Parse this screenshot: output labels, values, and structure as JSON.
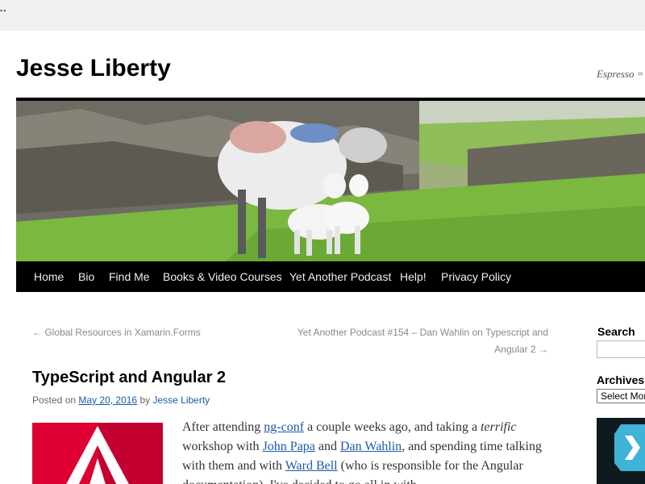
{
  "browser": {
    "dots": "▪▪"
  },
  "site": {
    "title": "Jesse Liberty",
    "tagline": "Espresso = Code"
  },
  "nav": {
    "items": [
      {
        "label": "Home"
      },
      {
        "label": "Bio"
      },
      {
        "label": "Find Me"
      },
      {
        "label": "Books & Video Courses"
      },
      {
        "label": "Yet Another Podcast"
      },
      {
        "label": "Help!"
      },
      {
        "label": "Privacy Policy"
      }
    ]
  },
  "post_nav": {
    "prev": "← Global Resources in Xamarin.Forms",
    "next": "Yet Another Podcast #154 – Dan Wahlin on Typescript and Angular 2 →"
  },
  "post": {
    "title": "TypeScript and Angular 2",
    "meta_posted": "Posted on",
    "date": "May 20, 2016",
    "meta_by": "by",
    "author": "Jesse Liberty",
    "p1": "After attending ",
    "link_ngconf": "ng-conf",
    "p2": " a couple weeks ago, and taking a ",
    "em_terrific": "terrific",
    "p3": " workshop with ",
    "link_john": "John Papa",
    "p4": " and ",
    "link_dan": "Dan Wahlin",
    "p5": ", and spending time talking with them and with ",
    "link_ward": "Ward Bell",
    "p6": " (who is responsible for the Angular documentation), I've decided to go all in with"
  },
  "sidebar": {
    "search_title": "Search",
    "archives_title": "Archives",
    "archives_select": "Select Month"
  },
  "colors": {
    "nav_bg": "#000000",
    "link": "#1b5aa8",
    "angular_red": "#dd0031"
  },
  "icons": {
    "next_arrow": "chevron-right-icon"
  }
}
